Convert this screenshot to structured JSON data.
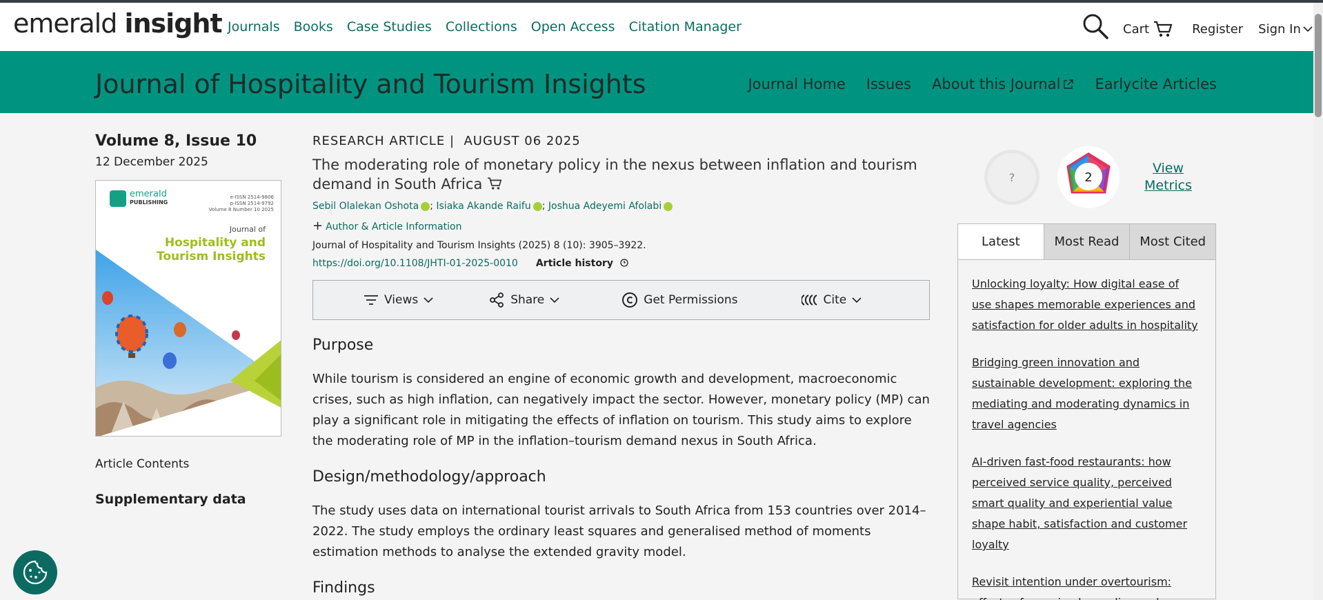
{
  "header": {
    "logo_light": "emerald",
    "logo_bold": "insight",
    "nav": [
      "Journals",
      "Books",
      "Case Studies",
      "Collections",
      "Open Access",
      "Citation Manager"
    ],
    "cart": "Cart",
    "register": "Register",
    "sign_in": "Sign In",
    "icons": [
      "search-icon",
      "cart-icon",
      "chevron-down-icon"
    ]
  },
  "journal": {
    "title": "Journal of Hospitality and Tourism Insights",
    "nav": [
      "Journal Home",
      "Issues",
      "About this Journal",
      "Earlycite Articles"
    ]
  },
  "sidebar": {
    "volume": "Volume 8, Issue 10",
    "date": "12 December 2025",
    "cover": {
      "publisher_main": "emerald",
      "publisher_sub": "PUBLISHING",
      "issn_line1": "e-ISSN 2514-9806",
      "issn_line2": "p-ISSN 2514-9792",
      "issn_line3": "Volume 8 Number 10 2025",
      "journal_of": "Journal of",
      "journal_name_1": "Hospitality and",
      "journal_name_2": "Tourism Insights"
    },
    "contents": "Article Contents",
    "supplementary": "Supplementary data"
  },
  "article": {
    "type": "RESEARCH ARTICLE",
    "separator": "|",
    "date": "AUGUST 06 2025",
    "title": "The moderating role of monetary policy in the nexus between inflation and tourism demand in South Africa",
    "authors": [
      "Sebil Olalekan Oshota",
      "Isiaka Akande Raifu",
      "Joshua Adeyemi Afolabi"
    ],
    "author_info": "Author & Article Information",
    "citation": "Journal of Hospitality and Tourism Insights (2025) 8 (10): 3905–3922.",
    "doi": "https://doi.org/10.1108/JHTI-01-2025-0010",
    "history": "Article history",
    "toolbar": {
      "views": "Views",
      "share": "Share",
      "permissions": "Get Permissions",
      "cite": "Cite"
    },
    "purpose_h": "Purpose",
    "purpose": "While tourism is considered an engine of economic growth and development, macroeconomic crises, such as high inflation, can negatively impact the sector. However, monetary policy (MP) can play a significant role in mitigating the effects of inflation on tourism. This study aims to explore the moderating role of MP in the inflation–tourism demand nexus in South Africa.",
    "design_h": "Design/methodology/approach",
    "design": "The study uses data on international tourist arrivals to South Africa from 153 countries over 2014–2022. The study employs the ordinary least squares and generalised method of moments estimation methods to analyse the extended gravity model.",
    "findings_h": "Findings"
  },
  "metrics": {
    "altmetric": "?",
    "dimensions": "2",
    "view_line1": "View",
    "view_line2": "Metrics"
  },
  "tabs": {
    "labels": [
      "Latest",
      "Most Read",
      "Most Cited"
    ],
    "active": "Latest",
    "items": [
      "Unlocking loyalty: How digital ease of use shapes memorable experiences and satisfaction for older adults in hospitality",
      "Bridging green innovation and sustainable development: exploring the mediating and moderating dynamics in travel agencies",
      "AI-driven fast-food restaurants: how perceived service quality, perceived smart quality and experiential value shape habit, satisfaction and customer loyalty",
      "Revisit intention under overtourism: effects of perceived crowding and"
    ]
  },
  "colors": {
    "brand_teal": "#009480",
    "link_teal": "#0b6b62",
    "cover_green": "#9dbd1e"
  }
}
